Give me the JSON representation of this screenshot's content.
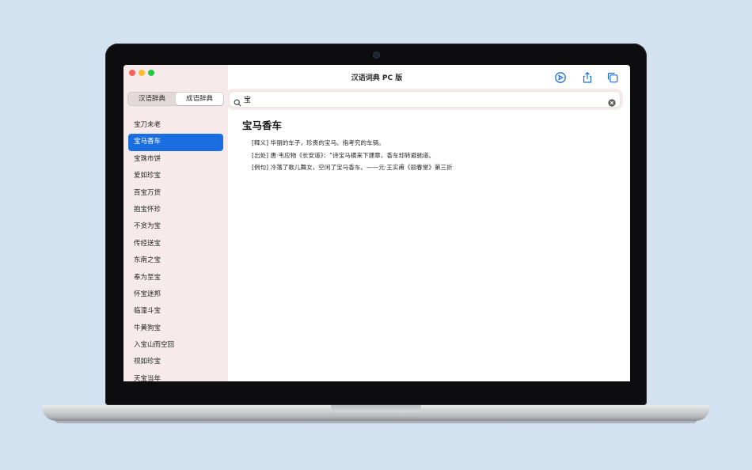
{
  "window": {
    "title": "汉语词典 PC 版"
  },
  "toolbar": {
    "icons": [
      "compass-icon",
      "share-icon",
      "copy-icon"
    ],
    "accent": "#1b6ee0"
  },
  "tabs": [
    {
      "label": "汉语辞典",
      "selected": false
    },
    {
      "label": "成语辞典",
      "selected": true
    }
  ],
  "search": {
    "value": "宝"
  },
  "list": {
    "selected_index": 1,
    "items": [
      "宝刀未老",
      "宝马香车",
      "宝珠市饼",
      "爱如珍宝",
      "百宝万货",
      "抱宝怀珍",
      "不贪为宝",
      "传经送宝",
      "东南之宝",
      "奉为至宝",
      "怀宝迷邦",
      "临潼斗宝",
      "牛黄狗宝",
      "入宝山而空回",
      "视如珍宝",
      "天宝当年"
    ]
  },
  "entry": {
    "title": "宝马香车",
    "lines": [
      "[释义] 华丽的车子，珍贵的宝马。指考究的车骑。",
      "[出处] 唐·韦应物《长安道》：“诗宝马横来下建章，香车却转避驰道。",
      "[例句] 冷落了歌儿舞女，空闲了宝马香车。——元·王实甫《丽春堂》第三折"
    ]
  },
  "colors": {
    "sidebar_bg": "#f6ebea",
    "selection": "#1b6ee0",
    "desktop_bg": "#d3e2f0"
  }
}
